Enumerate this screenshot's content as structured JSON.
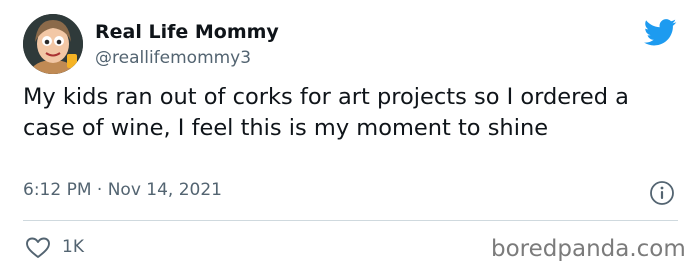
{
  "tweet": {
    "display_name": "Real Life Mommy",
    "handle": "@reallifemommy3",
    "text": "My kids ran out of corks for art projects so I ordered a case of wine, I feel this is my moment to shine",
    "timestamp": "6:12 PM · Nov 14, 2021",
    "like_count": "1K"
  },
  "icons": {
    "brand": "twitter-bird-icon",
    "info": "info-icon",
    "like": "heart-icon"
  },
  "colors": {
    "twitter_blue": "#1d9bf0",
    "secondary_text": "#536471",
    "divider": "#cfd9de"
  },
  "watermark": "boredpanda.com"
}
